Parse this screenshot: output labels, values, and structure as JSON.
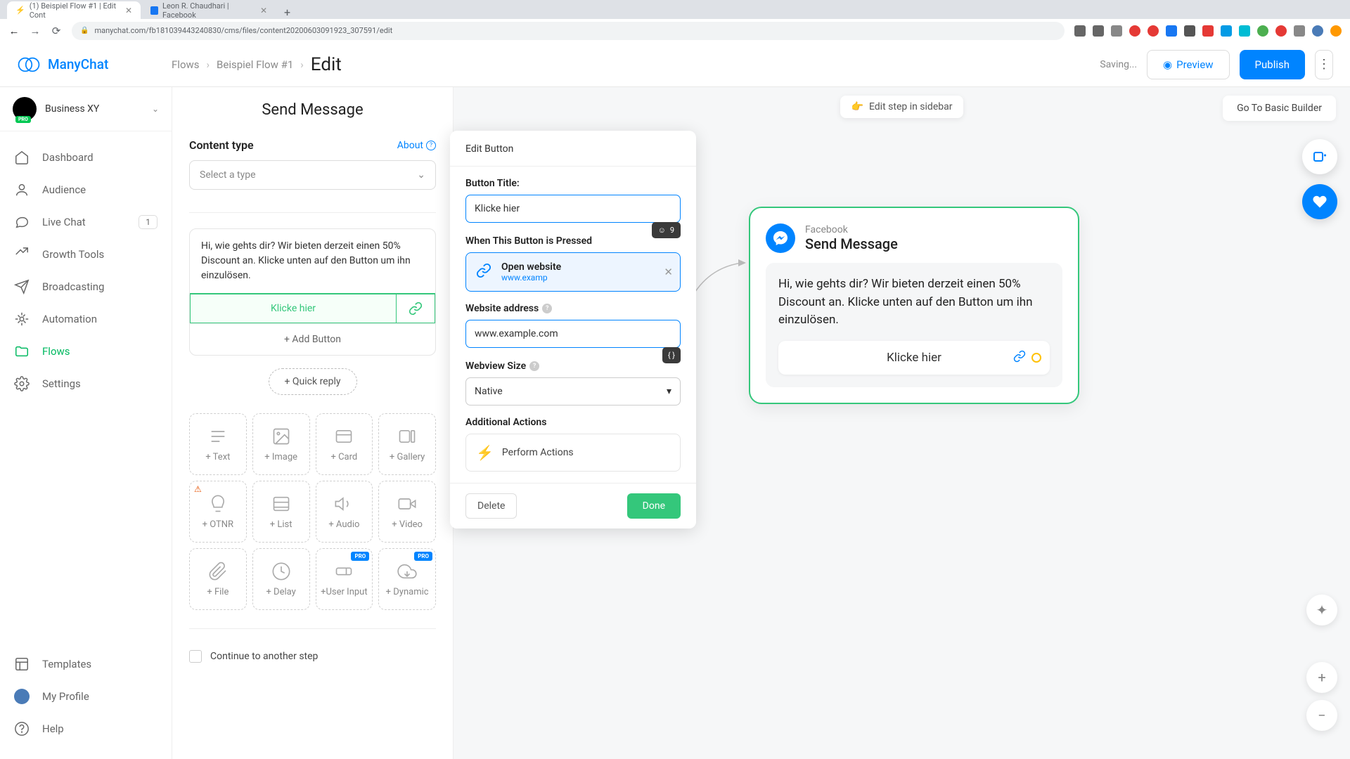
{
  "browser": {
    "tabs": [
      {
        "title": "(1) Beispiel Flow #1 | Edit Cont"
      },
      {
        "title": "Leon R. Chaudhari | Facebook"
      }
    ],
    "url": "manychat.com/fb181039443240830/cms/files/content20200603091923_307591/edit"
  },
  "brand": "ManyChat",
  "breadcrumb": {
    "flows": "Flows",
    "flow_name": "Beispiel Flow #1",
    "current": "Edit"
  },
  "header": {
    "saving": "Saving...",
    "preview": "Preview",
    "publish": "Publish"
  },
  "workspace": {
    "name": "Business XY",
    "badge": "PRO"
  },
  "nav": {
    "dashboard": "Dashboard",
    "audience": "Audience",
    "livechat": "Live Chat",
    "livechat_badge": "1",
    "growth": "Growth Tools",
    "broadcasting": "Broadcasting",
    "automation": "Automation",
    "flows": "Flows",
    "settings": "Settings",
    "templates": "Templates",
    "profile": "My Profile",
    "help": "Help"
  },
  "editor": {
    "title": "Send Message",
    "content_type_label": "Content type",
    "about": "About",
    "select_placeholder": "Select a type",
    "message_text": "Hi, wie gehts dir? Wir bieten derzeit einen 50% Discount an. Klicke unten auf den Button um ihn einzulösen.",
    "button_label": "Klicke hier",
    "add_button": "+ Add Button",
    "quick_reply": "+ Quick reply",
    "continue": "Continue to another step",
    "blocks": {
      "text": "+ Text",
      "image": "+ Image",
      "card": "+ Card",
      "gallery": "+ Gallery",
      "otnr": "+ OTNR",
      "list": "+ List",
      "audio": "+ Audio",
      "video": "+ Video",
      "file": "+ File",
      "delay": "+ Delay",
      "user_input": "+User Input",
      "dynamic": "+ Dynamic"
    }
  },
  "popover": {
    "header": "Edit Button",
    "button_title_label": "Button Title:",
    "button_title_value": "Klicke hier",
    "char_count": "9",
    "pressed_label": "When This Button is Pressed",
    "action_title": "Open website",
    "action_sub": "www.examp",
    "address_label": "Website address",
    "address_value": "www.example.com",
    "vars_icon": "{ }",
    "webview_label": "Webview Size",
    "webview_value": "Native",
    "additional_label": "Additional Actions",
    "perform": "Perform Actions",
    "delete": "Delete",
    "done": "Done"
  },
  "canvas": {
    "hint": "Edit step in sidebar",
    "basic_builder": "Go To Basic Builder",
    "node": {
      "platform": "Facebook",
      "title": "Send Message",
      "message": "Hi, wie gehts dir? Wir bieten derzeit einen 50% Discount an. Klicke unten auf den Button um ihn einzulösen.",
      "button": "Klicke hier"
    }
  }
}
